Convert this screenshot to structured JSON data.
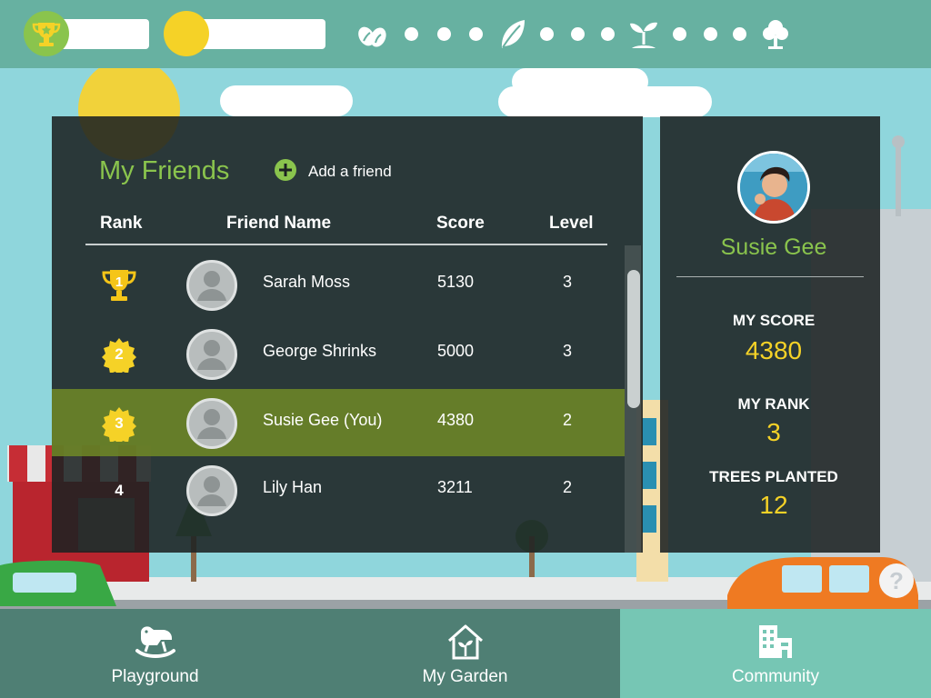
{
  "colors": {
    "accent_green": "#8ac44d",
    "gold": "#f5d227",
    "topbar": "#67b1a1",
    "nav_bg": "#4f7f74",
    "nav_active": "#76c6b4",
    "panel": "#1c2222",
    "highlight_row": "#738c26"
  },
  "topbar": {
    "trophy_icon": "trophy-icon",
    "sun_icon": "sun-icon",
    "progress_icons": [
      "seeds-icon",
      "leaf-icon",
      "sprout-icon",
      "tree-icon"
    ]
  },
  "friends": {
    "title": "My Friends",
    "add_friend_label": "Add a friend",
    "columns": {
      "rank": "Rank",
      "name": "Friend Name",
      "score": "Score",
      "level": "Level"
    },
    "rows": [
      {
        "rank": "1",
        "name": "Sarah Moss",
        "score": "5130",
        "level": "3"
      },
      {
        "rank": "2",
        "name": "George Shrinks",
        "score": "5000",
        "level": "3"
      },
      {
        "rank": "3",
        "name": "Susie Gee (You)",
        "score": "4380",
        "level": "2"
      },
      {
        "rank": "4",
        "name": "Lily Han",
        "score": "3211",
        "level": "2"
      }
    ]
  },
  "profile": {
    "name": "Susie Gee",
    "score_label": "MY SCORE",
    "score": "4380",
    "rank_label": "MY RANK",
    "rank": "3",
    "trees_label": "TREES PLANTED",
    "trees": "12"
  },
  "nav": {
    "items": [
      {
        "label": "Playground",
        "icon": "rocking-horse-icon"
      },
      {
        "label": "My Garden",
        "icon": "garden-house-icon"
      },
      {
        "label": "Community",
        "icon": "buildings-icon"
      }
    ],
    "active": "Community"
  },
  "help": {
    "label": "?"
  }
}
